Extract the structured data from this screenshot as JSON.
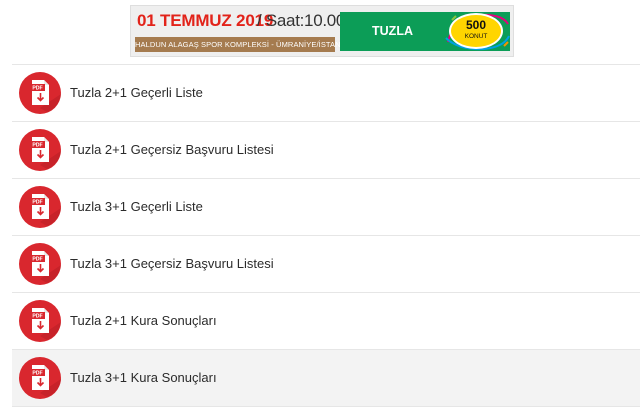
{
  "banner": {
    "date": "01 TEMMUZ 2019",
    "time": "/ Saat:10.00",
    "venue": "HALDUN ALAGAŞ SPOR KOMPLEKSİ - ÜMRANİYE/İSTANBUL",
    "location": "TUZLA",
    "badge_number": "500",
    "badge_label": "KONUT",
    "colors": {
      "date": "#e2231a",
      "venue_bg": "#a57b4f",
      "green": "#0c9d57",
      "badge": "#ffd500"
    }
  },
  "list": {
    "icon": "pdf-download-icon",
    "icon_color": "#d9272e",
    "items": [
      {
        "label": "Tuzla 2+1 Geçerli Liste"
      },
      {
        "label": "Tuzla 2+1 Geçersiz Başvuru Listesi"
      },
      {
        "label": "Tuzla 3+1 Geçerli Liste"
      },
      {
        "label": "Tuzla 3+1 Geçersiz Başvuru Listesi"
      },
      {
        "label": "Tuzla 2+1 Kura Sonuçları"
      },
      {
        "label": "Tuzla 3+1 Kura Sonuçları"
      }
    ]
  }
}
